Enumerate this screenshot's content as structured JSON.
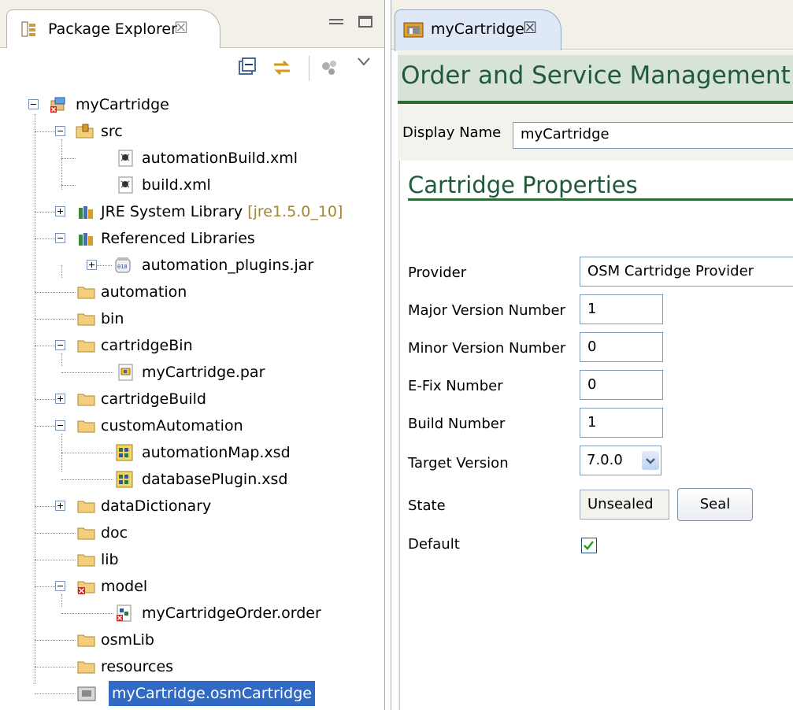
{
  "package_explorer": {
    "tab_label": "Package Explorer",
    "close_glyph": "☒",
    "tree": [
      {
        "label": "myCartridge",
        "annotation": "",
        "icon": "osm-project-icon",
        "expander": "minus"
      },
      {
        "label": "src",
        "annotation": "",
        "icon": "source-folder-icon",
        "expander": "minus"
      },
      {
        "label": "automationBuild.xml",
        "annotation": "",
        "icon": "ant-file-icon",
        "expander": ""
      },
      {
        "label": "build.xml",
        "annotation": "",
        "icon": "ant-file-icon",
        "expander": ""
      },
      {
        "label": "JRE System Library ",
        "annotation": "[jre1.5.0_10]",
        "icon": "library-icon",
        "expander": "plus"
      },
      {
        "label": "Referenced Libraries",
        "annotation": "",
        "icon": "library-icon",
        "expander": "minus"
      },
      {
        "label": "automation_plugins.jar",
        "annotation": "",
        "icon": "jar-icon",
        "expander": "plus"
      },
      {
        "label": "automation",
        "annotation": "",
        "icon": "folder-icon",
        "expander": ""
      },
      {
        "label": "bin",
        "annotation": "",
        "icon": "folder-icon",
        "expander": ""
      },
      {
        "label": "cartridgeBin",
        "annotation": "",
        "icon": "folder-icon",
        "expander": "minus"
      },
      {
        "label": "myCartridge.par",
        "annotation": "",
        "icon": "par-file-icon",
        "expander": ""
      },
      {
        "label": "cartridgeBuild",
        "annotation": "",
        "icon": "folder-icon",
        "expander": "plus"
      },
      {
        "label": "customAutomation",
        "annotation": "",
        "icon": "folder-icon",
        "expander": "minus"
      },
      {
        "label": "automationMap.xsd",
        "annotation": "",
        "icon": "xsd-file-icon",
        "expander": ""
      },
      {
        "label": "databasePlugin.xsd",
        "annotation": "",
        "icon": "xsd-file-icon",
        "expander": ""
      },
      {
        "label": "dataDictionary",
        "annotation": "",
        "icon": "folder-icon",
        "expander": "plus"
      },
      {
        "label": "doc",
        "annotation": "",
        "icon": "folder-icon",
        "expander": ""
      },
      {
        "label": "lib",
        "annotation": "",
        "icon": "folder-icon",
        "expander": ""
      },
      {
        "label": "model",
        "annotation": "",
        "icon": "folder-error-icon",
        "expander": "minus"
      },
      {
        "label": "myCartridgeOrder.order",
        "annotation": "",
        "icon": "order-file-icon",
        "expander": ""
      },
      {
        "label": "osmLib",
        "annotation": "",
        "icon": "folder-icon",
        "expander": ""
      },
      {
        "label": "resources",
        "annotation": "",
        "icon": "folder-icon",
        "expander": ""
      },
      {
        "label": "myCartridge.osmCartridge",
        "annotation": "",
        "icon": "cartridge-file-icon",
        "expander": "",
        "selected": true
      }
    ]
  },
  "editor": {
    "tab_label": "myCartridge",
    "close_glyph": "☒",
    "title": "Order and Service Management",
    "display_name_label": "Display Name",
    "display_name_value": "myCartridge",
    "section_title": "Cartridge Properties",
    "provider_label": "Provider",
    "provider_value": "OSM Cartridge Provider",
    "major_label": "Major Version Number",
    "major_value": "1",
    "minor_label": "Minor Version Number",
    "minor_value": "0",
    "efix_label": "E-Fix Number",
    "efix_value": "0",
    "build_label": "Build Number",
    "build_value": "1",
    "target_label": "Target Version",
    "target_value": "7.0.0",
    "state_label": "State",
    "state_value": "Unsealed",
    "seal_button": "Seal",
    "default_label": "Default",
    "default_checked": true
  },
  "colors": {
    "selection": "#316ac5",
    "section_green": "#215a3a",
    "title_bg": "#d8e3d8",
    "annotation": "#a38631"
  }
}
